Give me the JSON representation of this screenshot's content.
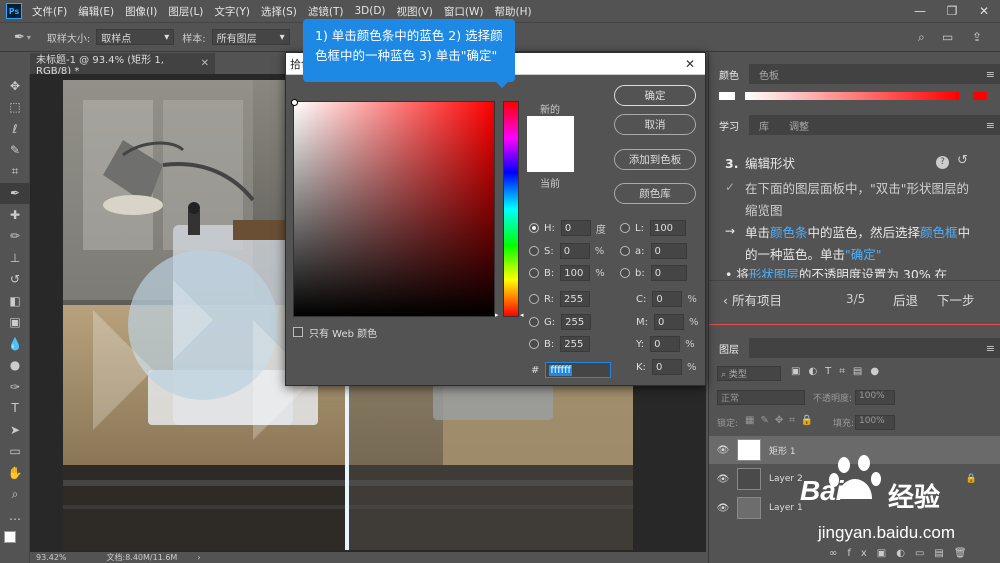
{
  "menubar": {
    "logo": "Ps",
    "items": [
      "文件(F)",
      "编辑(E)",
      "图像(I)",
      "图层(L)",
      "文字(Y)",
      "选择(S)",
      "滤镜(T)",
      "3D(D)",
      "视图(V)",
      "窗口(W)",
      "帮助(H)"
    ]
  },
  "options": {
    "sample_size_label": "取样大小:",
    "sample_size_value": "取样点",
    "sample_label": "样本:",
    "sample_value": "所有图层"
  },
  "document": {
    "tab_title": "未标题-1 @ 93.4% (矩形 1, RGB/8) *",
    "zoom": "93.42%",
    "doc_info": "文档:8.40M/11.6M"
  },
  "tooltip": {
    "line1": "1) 单击颜色条中的蓝色 2) 选择颜",
    "line2": "色框中的一种蓝色 3) 单击\"确定\""
  },
  "color_picker": {
    "title": "拾色",
    "new_label": "新的",
    "current_label": "当前",
    "ok": "确定",
    "cancel": "取消",
    "add_swatch": "添加到色板",
    "color_libraries": "颜色库",
    "web_only": "只有 Web 颜色",
    "fields": {
      "H": {
        "label": "H:",
        "value": "0",
        "unit": "度"
      },
      "S": {
        "label": "S:",
        "value": "0",
        "unit": "%"
      },
      "B": {
        "label": "B:",
        "value": "100",
        "unit": "%"
      },
      "R": {
        "label": "R:",
        "value": "255"
      },
      "G": {
        "label": "G:",
        "value": "255"
      },
      "Bl": {
        "label": "B:",
        "value": "255"
      },
      "L": {
        "label": "L:",
        "value": "100"
      },
      "a": {
        "label": "a:",
        "value": "0"
      },
      "b": {
        "label": "b:",
        "value": "0"
      },
      "C": {
        "label": "C:",
        "value": "0",
        "unit": "%"
      },
      "M": {
        "label": "M:",
        "value": "0",
        "unit": "%"
      },
      "Y": {
        "label": "Y:",
        "value": "0",
        "unit": "%"
      },
      "K": {
        "label": "K:",
        "value": "0",
        "unit": "%"
      },
      "hex_label": "#",
      "hex": "ffffff"
    },
    "colors": {
      "new": "#ffffff",
      "current": "#ffffff",
      "hue": "#ff0000"
    }
  },
  "color_panel": {
    "tabs": [
      "颜色",
      "色板"
    ]
  },
  "learn_panel": {
    "tabs": [
      "学习",
      "库",
      "调整"
    ],
    "step_number": "3.",
    "step_title": "编辑形状",
    "done_text_1": "在下面的图层面板中，\"双击\"形状图层的",
    "done_text_2": "缩览图",
    "cur_1a": "单击",
    "cur_1b": "颜色条",
    "cur_1c": "中的蓝色，然后选择",
    "cur_1d": "颜色框",
    "cur_1e": "中",
    "cur_2a": "的一种蓝色。单击",
    "cur_2b": "\"确定\"",
    "next_hint_a": "将",
    "next_hint_b": "形状图层",
    "next_hint_c": "的不透明度设置为 30% 在",
    "all_items": "所有项目",
    "progress": "3/5",
    "back": "后退",
    "next": "下一步"
  },
  "layers_panel": {
    "title": "图层",
    "filter": "类型",
    "blend_mode": "正常",
    "opacity_label": "不透明度:",
    "opacity": "100%",
    "lock_label": "锁定:",
    "fill_label": "填充:",
    "fill": "100%",
    "layers": [
      {
        "name": "矩形 1"
      },
      {
        "name": "Layer 2"
      },
      {
        "name": "Layer 1"
      }
    ]
  },
  "watermark": {
    "brand": "Bai",
    "brand2": "经验",
    "url": "jingyan.baidu.com"
  }
}
